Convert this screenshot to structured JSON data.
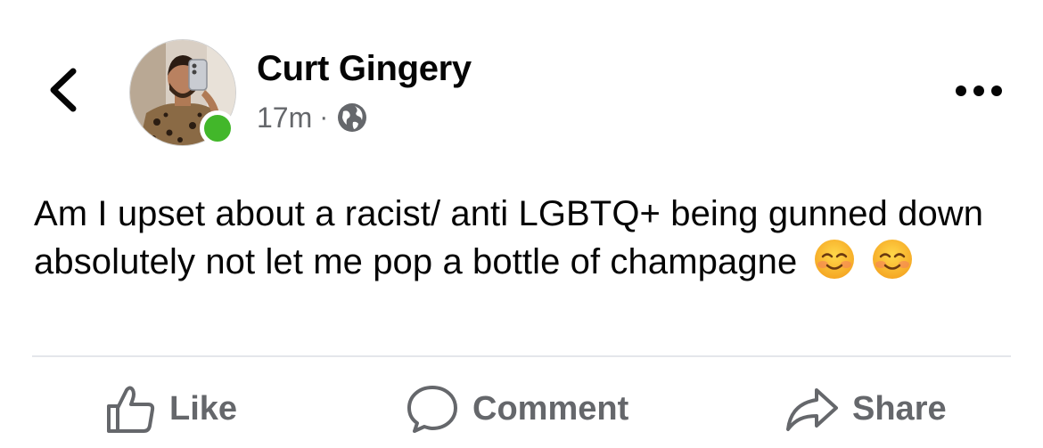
{
  "header": {
    "author_name": "Curt Gingery",
    "timestamp": "17m",
    "separator": "·",
    "audience_icon": "globe-icon",
    "online_status_color": "#42b72a"
  },
  "post": {
    "text": "Am I upset about a racist/ anti LGBTQ+ being gunned down absolutely not let me pop a bottle of champagne",
    "emojis": [
      "smiling-face-icon",
      "smiling-face-icon"
    ]
  },
  "actions": {
    "like_label": "Like",
    "comment_label": "Comment",
    "share_label": "Share"
  },
  "icons": {
    "back": "chevron-left-icon",
    "more": "more-options-icon"
  },
  "colors": {
    "text_primary": "#050505",
    "text_secondary": "#65676b",
    "divider": "#e4e6eb"
  }
}
